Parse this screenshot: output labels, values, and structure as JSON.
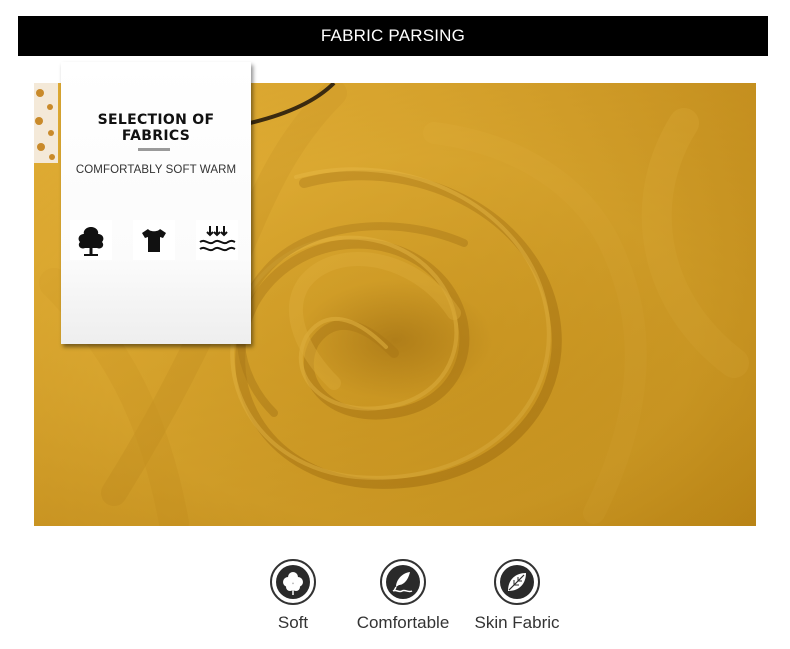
{
  "banner": {
    "title": "FABRIC PARSING"
  },
  "card": {
    "title": "SELECTION OF FABRICS",
    "subtitle": "COMFORTABLY SOFT WARM",
    "icons": [
      "cotton-tree-icon",
      "tshirt-icon",
      "water-wave-icon"
    ]
  },
  "features": [
    {
      "label": "Soft",
      "icon": "cotton-flower-icon"
    },
    {
      "label": "Comfortable",
      "icon": "feather-icon"
    },
    {
      "label": "Skin Fabric",
      "icon": "modal-leaf-icon"
    }
  ],
  "colors": {
    "fabric": "#d9a321",
    "banner": "#000000",
    "text": "#333333"
  }
}
